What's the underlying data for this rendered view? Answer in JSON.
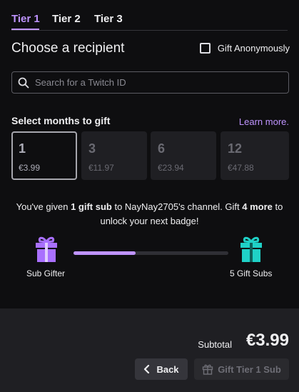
{
  "tabs": [
    {
      "label": "Tier 1",
      "active": true
    },
    {
      "label": "Tier 2",
      "active": false
    },
    {
      "label": "Tier 3",
      "active": false
    }
  ],
  "recipient": {
    "heading": "Choose a recipient",
    "anonymous_label": "Gift Anonymously",
    "anonymous_checked": false
  },
  "search": {
    "placeholder": "Search for a Twitch ID",
    "value": ""
  },
  "months": {
    "title": "Select months to gift",
    "learn_more": "Learn more.",
    "options": [
      {
        "count": "1",
        "price": "€3.99",
        "selected": true
      },
      {
        "count": "3",
        "price": "€11.97",
        "selected": false
      },
      {
        "count": "6",
        "price": "€23.94",
        "selected": false
      },
      {
        "count": "12",
        "price": "€47.88",
        "selected": false
      }
    ]
  },
  "progress": {
    "msg_part1": "You've given ",
    "msg_bold1": "1 gift sub",
    "msg_part2": " to NayNay2705's channel. Gift ",
    "msg_bold2": "4 more",
    "msg_part3": " to unlock your next badge!",
    "current_badge": "Sub Gifter",
    "next_badge": "5 Gift Subs",
    "fraction": 0.4
  },
  "footer": {
    "subtotal_label": "Subtotal",
    "subtotal_value": "€3.99",
    "back_label": "Back",
    "gift_label": "Gift Tier 1 Sub"
  },
  "colors": {
    "accent": "#bf94ff",
    "badge_purple": "#a970ff",
    "badge_teal": "#1fd1c7"
  },
  "icons": [
    "search-icon",
    "gift-icon",
    "chevron-left-icon"
  ]
}
